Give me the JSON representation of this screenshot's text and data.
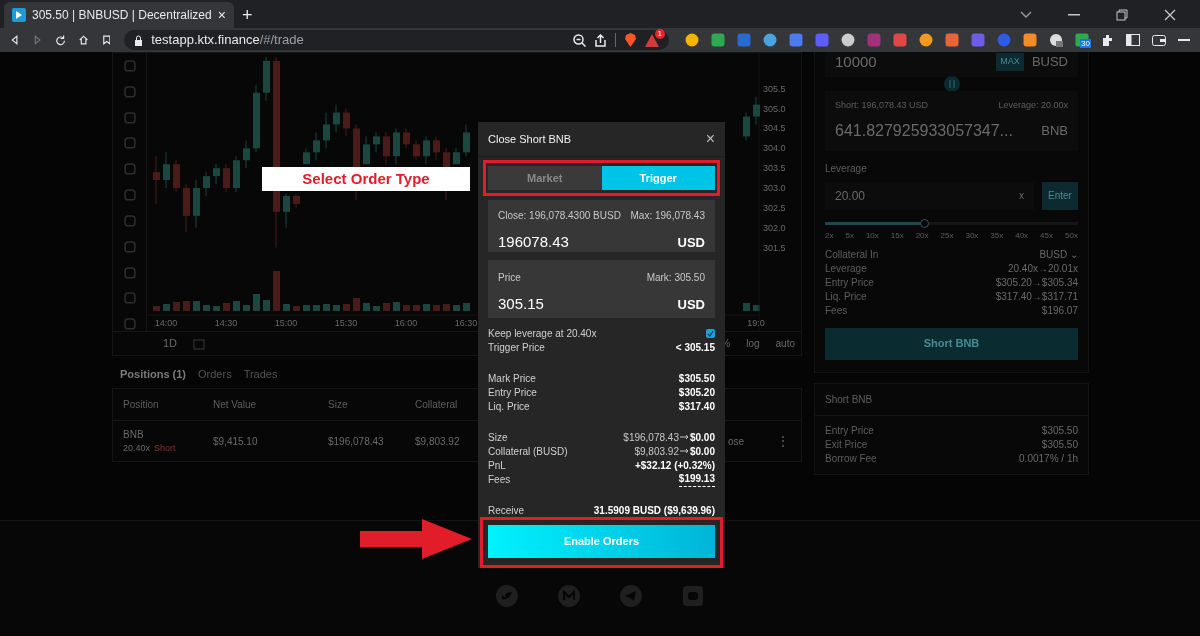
{
  "browser": {
    "tab_title": "305.50 | BNBUSD | Decentralized",
    "tab_close": "×",
    "new_tab": "+",
    "url_host": "testapp.ktx.finance",
    "url_path": "/#/trade",
    "alert_badge": "1",
    "calendar_badge": "30"
  },
  "chart": {
    "chart_data": {
      "type": "candlestick",
      "ylim": [
        299.4,
        306.4
      ],
      "categories": [
        null,
        "14:00",
        null,
        null,
        null,
        null,
        null,
        "14:30",
        null,
        null,
        null,
        null,
        null,
        "15:00",
        null,
        null,
        null,
        null,
        null,
        "15:30",
        null,
        null,
        null,
        null,
        null,
        "16:00",
        null,
        null,
        null,
        null,
        null,
        "16:30",
        null,
        null,
        null,
        null,
        null,
        null,
        null,
        null,
        null,
        null,
        null,
        null,
        null,
        null,
        null,
        null,
        null,
        null,
        null,
        null,
        null,
        null,
        null,
        null,
        null,
        null,
        null,
        null,
        "19:0"
      ],
      "ohlc": [
        [
          303.4,
          303.8,
          302.6,
          303.2
        ],
        [
          303.2,
          303.9,
          303.0,
          303.6
        ],
        [
          303.6,
          303.7,
          302.9,
          303.0
        ],
        [
          303.0,
          303.1,
          301.9,
          302.3
        ],
        [
          302.3,
          303.2,
          302.0,
          303.0
        ],
        [
          303.0,
          303.4,
          302.8,
          303.3
        ],
        [
          303.3,
          303.6,
          303.1,
          303.5
        ],
        [
          303.5,
          303.6,
          302.9,
          303.0
        ],
        [
          303.0,
          303.8,
          302.9,
          303.7
        ],
        [
          303.7,
          304.2,
          303.5,
          304.0
        ],
        [
          304.0,
          305.6,
          303.9,
          305.4
        ],
        [
          305.4,
          306.3,
          305.2,
          306.2
        ],
        [
          306.2,
          306.3,
          301.5,
          302.4
        ],
        [
          302.4,
          302.85,
          302.0,
          302.8
        ],
        [
          302.8,
          302.85,
          302.5,
          302.6
        ],
        [
          303.6,
          304.0,
          303.6,
          303.9
        ],
        [
          303.9,
          304.4,
          303.7,
          304.2
        ],
        [
          304.2,
          304.9,
          304.0,
          304.6
        ],
        [
          304.6,
          305.1,
          304.4,
          304.9
        ],
        [
          304.9,
          305.0,
          304.3,
          304.5
        ],
        [
          304.5,
          304.6,
          302.7,
          303.5
        ],
        [
          303.6,
          304.3,
          303.6,
          304.1
        ],
        [
          304.1,
          304.4,
          303.9,
          304.3
        ],
        [
          304.3,
          304.4,
          303.6,
          303.8
        ],
        [
          303.8,
          304.5,
          303.6,
          304.4
        ],
        [
          304.4,
          304.5,
          304.0,
          304.1
        ],
        [
          304.1,
          304.2,
          303.7,
          303.8
        ],
        [
          303.8,
          304.3,
          303.6,
          304.2
        ],
        [
          304.2,
          304.3,
          303.7,
          303.9
        ],
        [
          303.9,
          304.0,
          302.7,
          303.5
        ],
        [
          303.6,
          304.0,
          303.6,
          303.9
        ],
        [
          303.9,
          304.6,
          303.8,
          304.4
        ],
        null,
        null,
        null,
        null,
        null,
        null,
        null,
        null,
        null,
        null,
        null,
        null,
        null,
        null,
        null,
        null,
        null,
        null,
        null,
        null,
        null,
        null,
        null,
        null,
        null,
        null,
        null,
        [
          304.3,
          304.9,
          304.2,
          304.8
        ],
        [
          304.8,
          305.3,
          304.6,
          305.1
        ]
      ],
      "yticks": [
        {
          "value": 305.5,
          "label": "305.5"
        },
        {
          "value": 305,
          "label": "305.0"
        },
        {
          "value": 304.5,
          "label": "304.5"
        },
        {
          "value": 304,
          "label": "304.0"
        },
        {
          "value": 303.5,
          "label": "303.5"
        },
        {
          "value": 303,
          "label": "303.0"
        },
        {
          "value": 302.5,
          "label": "302.5"
        },
        {
          "value": 302,
          "label": "302.0"
        },
        {
          "value": 301.5,
          "label": "301.5"
        }
      ]
    },
    "interval": "1D",
    "scale_options": [
      "%",
      "log",
      "auto"
    ]
  },
  "positions": {
    "tabs": [
      {
        "label": "Positions (1)",
        "selected": true
      },
      {
        "label": "Orders",
        "selected": false
      },
      {
        "label": "Trades",
        "selected": false
      }
    ],
    "columns": [
      "Position",
      "Net Value",
      "Size",
      "Collateral"
    ],
    "rows": [
      {
        "market": "BNB",
        "leverage": "20.40x",
        "side": "Short",
        "net_value": "$9,415.10",
        "size": "$196,078.43",
        "collateral": "$9,803.92",
        "action": "ose",
        "menu": "⋮"
      }
    ]
  },
  "order_panel": {
    "pay_value": "10000",
    "max_label": "MAX",
    "pay_token": "BUSD",
    "short_label": "Short: 196,078.43 USD",
    "leverage_label": "Leverage: 20.00x",
    "short_value": "641.827925933057347...",
    "short_token": "BNB",
    "leverage_title": "Leverage",
    "leverage_value": "20.00",
    "leverage_suffix": "x",
    "enter_label": "Enter",
    "slider": {
      "level": 0.39
    },
    "slider_marks": [
      "2x",
      "5x",
      "10x",
      "15x",
      "20x",
      "25x",
      "30x",
      "35x",
      "40x",
      "45x",
      "50x"
    ],
    "info": [
      {
        "label": "Collateral In",
        "value": "BUSD ⌄"
      },
      {
        "label": "Leverage",
        "value": "20.40x→20.01x"
      },
      {
        "label": "Entry Price",
        "value": "$305.20→$305.34"
      },
      {
        "label": "Liq. Price",
        "value": "$317.40→$317.71"
      },
      {
        "label": "Fees",
        "value": "$196.07"
      }
    ],
    "submit": "Short BNB",
    "section_title": "Short BNB",
    "section_rows": [
      {
        "label": "Entry Price",
        "value": "$305.50"
      },
      {
        "label": "Exit Price",
        "value": "$305.50"
      },
      {
        "label": "Borrow Fee",
        "value": "0.0017% / 1h"
      }
    ]
  },
  "modal": {
    "title": "Close Short BNB",
    "close": "×",
    "tabs": [
      {
        "label": "Market",
        "selected": false
      },
      {
        "label": "Trigger",
        "selected": true
      }
    ],
    "close_card": {
      "label": "Close: 196,078.4300 BUSD",
      "hint": "Max: 196,078.43",
      "value": "196078.43",
      "unit": "USD"
    },
    "price_card": {
      "label": "Price",
      "hint": "Mark: 305.50",
      "value": "305.15",
      "unit": "USD"
    },
    "keep_leverage": {
      "label": "Keep leverage at 20.40x",
      "checked": true
    },
    "trigger": {
      "label": "Trigger Price",
      "value": "< 305.15"
    },
    "price_rows": [
      {
        "label": "Mark Price",
        "value": "$305.50"
      },
      {
        "label": "Entry Price",
        "value": "$305.20"
      },
      {
        "label": "Liq. Price",
        "value": "$317.40"
      }
    ],
    "change_rows": [
      {
        "label": "Size",
        "from": "$196,078.43",
        "to": "$0.00",
        "underlined": false
      },
      {
        "label": "Collateral (BUSD)",
        "from": "$9,803.92",
        "to": "$0.00",
        "underlined": false
      },
      {
        "label": "PnL",
        "value": "+$32.12 (+0.32%)",
        "underlined": false
      },
      {
        "label": "Fees",
        "value": "$199.13",
        "underlined": true
      }
    ],
    "receive": {
      "label": "Receive",
      "value": "31.5909 BUSD ($9,639.96)"
    },
    "button": "Enable Orders"
  },
  "annotation": {
    "label": "Select Order Type"
  }
}
